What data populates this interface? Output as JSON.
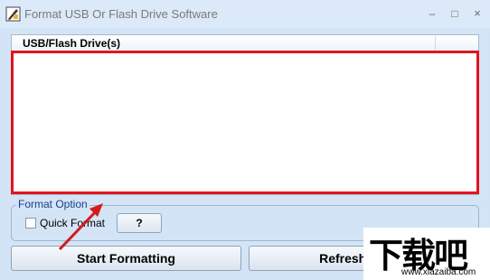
{
  "window": {
    "title": "Format USB Or Flash Drive Software",
    "minimize_label": "–",
    "maximize_label": "□",
    "close_label": "×"
  },
  "drive_list": {
    "columns": [
      "USB/Flash Drive(s)"
    ],
    "rows": []
  },
  "format_option": {
    "group_title": "Format Option",
    "quick_format_label": "Quick Format",
    "quick_format_checked": false,
    "help_label": "?"
  },
  "actions": {
    "start_label": "Start Formatting",
    "refresh_label": "Refresh Drives"
  },
  "watermark": {
    "logo_text": "下载吧",
    "url": "www.xiazaiba.com"
  },
  "colors": {
    "highlight": "#e2141f",
    "arrow": "#d41a1a",
    "background": "#d3e4f6"
  },
  "icons": {
    "app": "pen-tool-icon",
    "arrow": "annotation-arrow-icon"
  }
}
